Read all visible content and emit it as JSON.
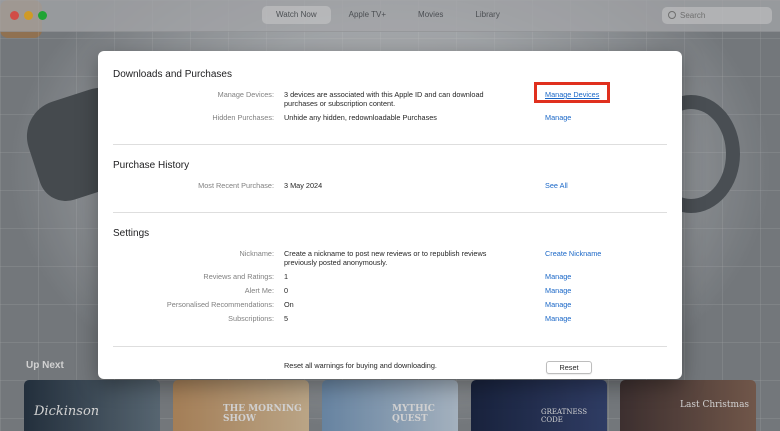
{
  "toolbar": {
    "tabs": [
      "Watch Now",
      "Apple TV+",
      "Movies",
      "Library"
    ],
    "search_placeholder": "Search"
  },
  "background": {
    "up_next_label": "Up Next",
    "cards": [
      "Dickinson",
      "THE MORNING SHOW",
      "MYTHIC QUEST",
      "GREATNESS CODE",
      "Last Christmas"
    ]
  },
  "dialog": {
    "downloads": {
      "title": "Downloads and Purchases",
      "manage_devices_label": "Manage Devices:",
      "manage_devices_value": "3 devices are associated with this Apple ID and can download purchases or subscription content.",
      "manage_devices_action": "Manage Devices",
      "hidden_label": "Hidden Purchases:",
      "hidden_value": "Unhide any hidden, redownloadable Purchases",
      "hidden_action": "Manage"
    },
    "history": {
      "title": "Purchase History",
      "recent_label": "Most Recent Purchase:",
      "recent_value": "3 May 2024",
      "recent_action": "See All"
    },
    "settings": {
      "title": "Settings",
      "nickname_label": "Nickname:",
      "nickname_value": "Create a nickname to post new reviews or to republish reviews previously posted anonymously.",
      "nickname_action": "Create Nickname",
      "reviews_label": "Reviews and Ratings:",
      "reviews_value": "1",
      "reviews_action": "Manage",
      "alert_label": "Alert Me:",
      "alert_value": "0",
      "alert_action": "Manage",
      "personalised_label": "Personalised Recommendations:",
      "personalised_value": "On",
      "personalised_action": "Manage",
      "subscriptions_label": "Subscriptions:",
      "subscriptions_value": "5",
      "subscriptions_action": "Manage"
    },
    "reset": {
      "text": "Reset all warnings for buying and downloading.",
      "button": "Reset"
    }
  },
  "colors": {
    "link": "#1a67c7",
    "highlight": "#e0301e",
    "traffic_red": "#fe5f57",
    "traffic_yellow": "#febc2e",
    "traffic_green": "#28c840"
  }
}
